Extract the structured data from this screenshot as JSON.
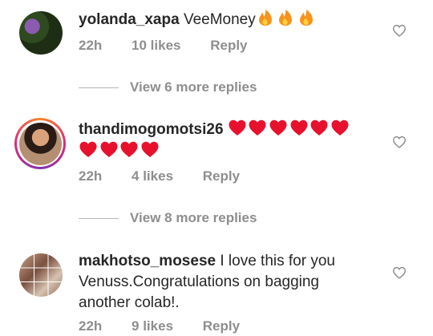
{
  "comments": [
    {
      "username": "yolanda_xapa",
      "text": "VeeMoney",
      "emoji": [
        "fire",
        "fire",
        "fire"
      ],
      "time": "22h",
      "likes": "10 likes",
      "reply": "Reply",
      "avatar_icon": "avatar-photo"
    },
    {
      "username": "thandimogomotsi26",
      "text": "",
      "emoji": [
        "red-heart",
        "red-heart",
        "red-heart",
        "red-heart",
        "red-heart",
        "red-heart",
        "red-heart",
        "red-heart",
        "red-heart",
        "red-heart"
      ],
      "time": "22h",
      "likes": "4 likes",
      "reply": "Reply",
      "avatar_icon": "avatar-story-ring"
    },
    {
      "username": "makhotso_mosese",
      "text": "I love this for you Venuss.Congratulations on bagging another colab!.",
      "emoji": [],
      "time": "22h",
      "likes": "9 likes",
      "reply": "Reply",
      "avatar_icon": "avatar-collage"
    }
  ],
  "view_more": [
    "View 6 more replies",
    "View 8 more replies"
  ],
  "colors": {
    "text": "#262626",
    "meta": "#8e8e8e",
    "heart_emoji": "#e8112d",
    "fire_emoji": "#f7931e"
  }
}
